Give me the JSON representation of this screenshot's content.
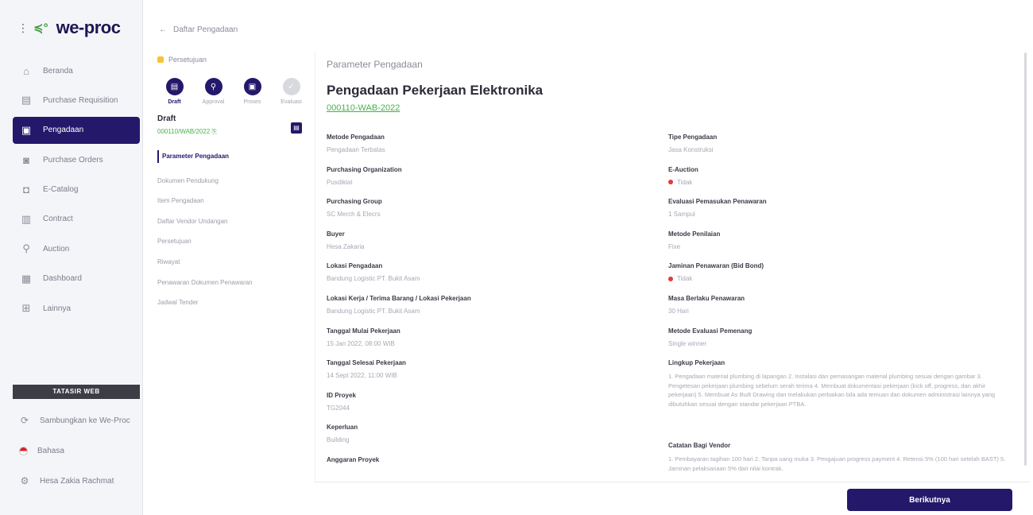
{
  "sidebar": {
    "logo": "we-proc",
    "items": [
      {
        "label": "Beranda",
        "icon": "home-icon",
        "active": false
      },
      {
        "label": "Purchase Requisition",
        "icon": "document-icon",
        "active": false
      },
      {
        "label": "Pengadaan",
        "icon": "clipboard-icon",
        "active": true
      },
      {
        "label": "Purchase Orders",
        "icon": "box-icon",
        "active": false
      },
      {
        "label": "E-Catalog",
        "icon": "catalog-icon",
        "active": false
      },
      {
        "label": "Contract",
        "icon": "contract-icon",
        "active": false
      },
      {
        "label": "Auction",
        "icon": "auction-icon",
        "active": false
      },
      {
        "label": "Dashboard",
        "icon": "dashboard-icon",
        "active": false
      },
      {
        "label": "Lainnya",
        "icon": "grid-icon",
        "active": false
      }
    ],
    "tacs_label": "TATASIR WEB",
    "bottom": [
      {
        "label": "Sambungkan ke We-Proc",
        "icon": "link-icon"
      },
      {
        "label": "Bahasa",
        "icon": "flag-icon"
      },
      {
        "label": "Hesa Zakia Rachmat",
        "icon": "user-icon"
      }
    ]
  },
  "back_link": "Daftar Pengadaan",
  "progress": {
    "status": "Persetujuan",
    "steps": [
      {
        "label": "Draft",
        "icon": "document-icon",
        "state": "current"
      },
      {
        "label": "Approval",
        "icon": "search-icon",
        "state": "done"
      },
      {
        "label": "Proses",
        "icon": "file-icon",
        "state": "done"
      },
      {
        "label": "Evaluasi",
        "icon": "check-icon",
        "state": "off"
      }
    ]
  },
  "status_block": {
    "title": "Draft",
    "code": "000110/WAB/2022"
  },
  "sections": [
    "Parameter Pengadaan",
    "Dokumen Pendukung",
    "Item Pengadaan",
    "Daftar Vendor Undangan",
    "Persetujuan",
    "Riwayat",
    "Penawaran Dokumen Penawaran",
    "Jadwal Tender"
  ],
  "main": {
    "subtitle": "Parameter Pengadaan",
    "title": "Pengadaan Pekerjaan Elektronika",
    "code": "000110-WAB-2022",
    "left_fields": [
      {
        "key": "Metode Pengadaan",
        "value": "Pengadaan Terbatas"
      },
      {
        "key": "Purchasing Organization",
        "value": "Pusdiklat"
      },
      {
        "key": "Purchasing Group",
        "value": "SC Merch & Elecrs"
      },
      {
        "key": "Buyer",
        "value": "Hesa Zakaria"
      },
      {
        "key": "Lokasi Pengadaan",
        "value": "Bandung Logistic PT. Bukit Asam"
      },
      {
        "key": "Lokasi Kerja / Terima Barang / Lokasi Pekerjaan",
        "value": "Bandung Logistic PT. Bukit Asam"
      },
      {
        "key": "Tanggal Mulai Pekerjaan",
        "value": "15 Jan 2022, 08:00 WIB"
      },
      {
        "key": "Tanggal Selesai Pekerjaan",
        "value": "14 Sept 2022, 11:00 WIB"
      },
      {
        "key": "ID Proyek",
        "value": "TG2044"
      },
      {
        "key": "Keperluan",
        "value": "Building"
      },
      {
        "key": "Anggaran Proyek",
        "value": ""
      }
    ],
    "right_fields": [
      {
        "key": "Tipe Pengadaan",
        "value": "Jasa Konstruksi",
        "flag": false
      },
      {
        "key": "E-Auction",
        "value": "Tidak",
        "flag": true
      },
      {
        "key": "Evaluasi Pemasukan Penawaran",
        "value": "1 Sampul",
        "flag": false
      },
      {
        "key": "Metode Penilaian",
        "value": "Fixe",
        "flag": false
      },
      {
        "key": "Jaminan Penawaran (Bid Bond)",
        "value": "Tidak",
        "flag": true
      },
      {
        "key": "Masa Berlaku Penawaran",
        "value": "30 Hari",
        "flag": false
      },
      {
        "key": "Metode Evaluasi Pemenang",
        "value": "Single winner",
        "flag": false
      }
    ],
    "scope": {
      "key": "Lingkup Pekerjaan",
      "value": "1. Pengadaan material plumbing di lapangan 2. Instalasi dan pemasangan material plumbing sesuai dengan gambar 3. Pengetesan pekerjaan plumbing sebelum serah terima 4. Membuat dokumentasi pekerjaan (kick off, progress, dan akhir pekerjaan) 5. Membuat As Built Drawing dan melakukan perbaikan bila ada temuan dan dokumen administrasi lainnya yang dibutuhkan sesuai dengan standar pekerjaan PTBA."
    },
    "notes": {
      "key": "Catatan Bagi Vendor",
      "value": "1. Pembayaran tagihan 100 hari 2. Tanpa uang muka 3. Pengajuan progress payment 4. Retensi 5% (100 hari setelah BAST) 5. Jaminan pelaksanaan 5% dari nilai kontrak."
    }
  },
  "footer": {
    "next_label": "Berikutnya"
  }
}
